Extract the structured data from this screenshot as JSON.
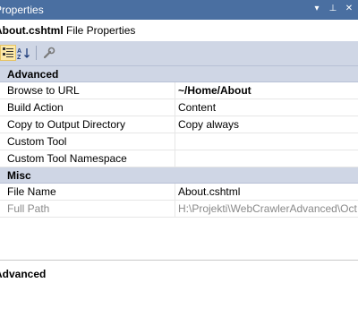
{
  "window": {
    "title": "Properties",
    "buttons": [
      "▾",
      "⊥",
      "✕"
    ]
  },
  "object_selector": {
    "name": "About.cshtml",
    "type": "File Properties"
  },
  "toolbar": {
    "categorized_icon": "categorized-icon",
    "alphabetical_icon": "alphabetical-icon",
    "property_pages_icon": "wrench-icon"
  },
  "grid": {
    "categories": [
      {
        "label": "Advanced",
        "rows": [
          {
            "name": "Browse to URL",
            "value": "~/Home/About",
            "bold": true,
            "disabled": false
          },
          {
            "name": "Build Action",
            "value": "Content",
            "bold": false,
            "disabled": false
          },
          {
            "name": "Copy to Output Directory",
            "value": "Copy always",
            "bold": false,
            "disabled": false
          },
          {
            "name": "Custom Tool",
            "value": "",
            "bold": false,
            "disabled": false
          },
          {
            "name": "Custom Tool Namespace",
            "value": "",
            "bold": false,
            "disabled": false
          }
        ]
      },
      {
        "label": "Misc",
        "rows": [
          {
            "name": "File Name",
            "value": "About.cshtml",
            "bold": false,
            "disabled": false
          },
          {
            "name": "Full Path",
            "value": "H:\\Projekti\\WebCrawlerAdvanced\\Oct",
            "bold": false,
            "disabled": true
          }
        ]
      }
    ]
  },
  "description": {
    "title": "Advanced"
  },
  "colors": {
    "titlebar": "#4a6fa1",
    "category_band": "#cfd6e5",
    "toolbar_checked": "#fde9a8"
  }
}
